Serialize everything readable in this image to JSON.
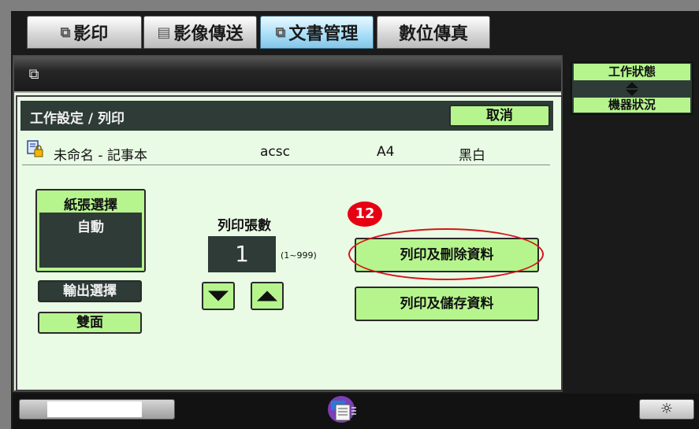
{
  "tabs": [
    {
      "label": "影印",
      "icon": "copy-icon",
      "active": false
    },
    {
      "label": "影像傳送",
      "icon": "image-send-icon",
      "active": false
    },
    {
      "label": "文書管理",
      "icon": "document-filing-icon",
      "active": true
    },
    {
      "label": "數位傳真",
      "icon": "",
      "active": false
    }
  ],
  "panel": {
    "title_icon": "document-filing-icon",
    "job_title": "工作設定 / 列印",
    "cancel_label": "取消"
  },
  "document": {
    "name": "未命名 - 記事本",
    "user": "acsc",
    "paper_size": "A4",
    "color_mode": "黑白"
  },
  "paper_select": {
    "label": "紙張選擇",
    "value": "自動"
  },
  "output_label": "輸出選擇",
  "duplex_label": "雙面",
  "copies": {
    "label": "列印張數",
    "value": "1",
    "range": "(1~999)"
  },
  "step_number": "12",
  "actions": {
    "print_delete": "列印及刪除資料",
    "print_save": "列印及儲存資料"
  },
  "status": {
    "top": "工作狀態",
    "bottom": "機器狀況"
  },
  "colors": {
    "accent_green": "#b6f58e",
    "dark_panel": "#2e3b36",
    "highlight": "#d7141a"
  }
}
